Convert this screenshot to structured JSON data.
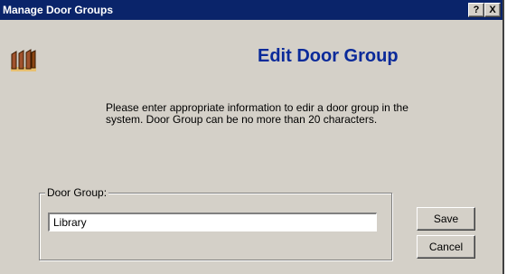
{
  "window": {
    "title": "Manage Door Groups",
    "help_label": "?",
    "close_label": "X"
  },
  "header": {
    "title": "Edit Door Group",
    "icon": "doors-icon"
  },
  "instructions": "Please enter appropriate information to edir a door group in the system. Door Group can be no more than 20 characters.",
  "form": {
    "group_label": "Door Group:",
    "door_group_value": "Library"
  },
  "buttons": {
    "save": "Save",
    "cancel": "Cancel"
  },
  "colors": {
    "titlebar": "#0a246a",
    "heading": "#0a2a9a",
    "face": "#d4d0c8"
  }
}
